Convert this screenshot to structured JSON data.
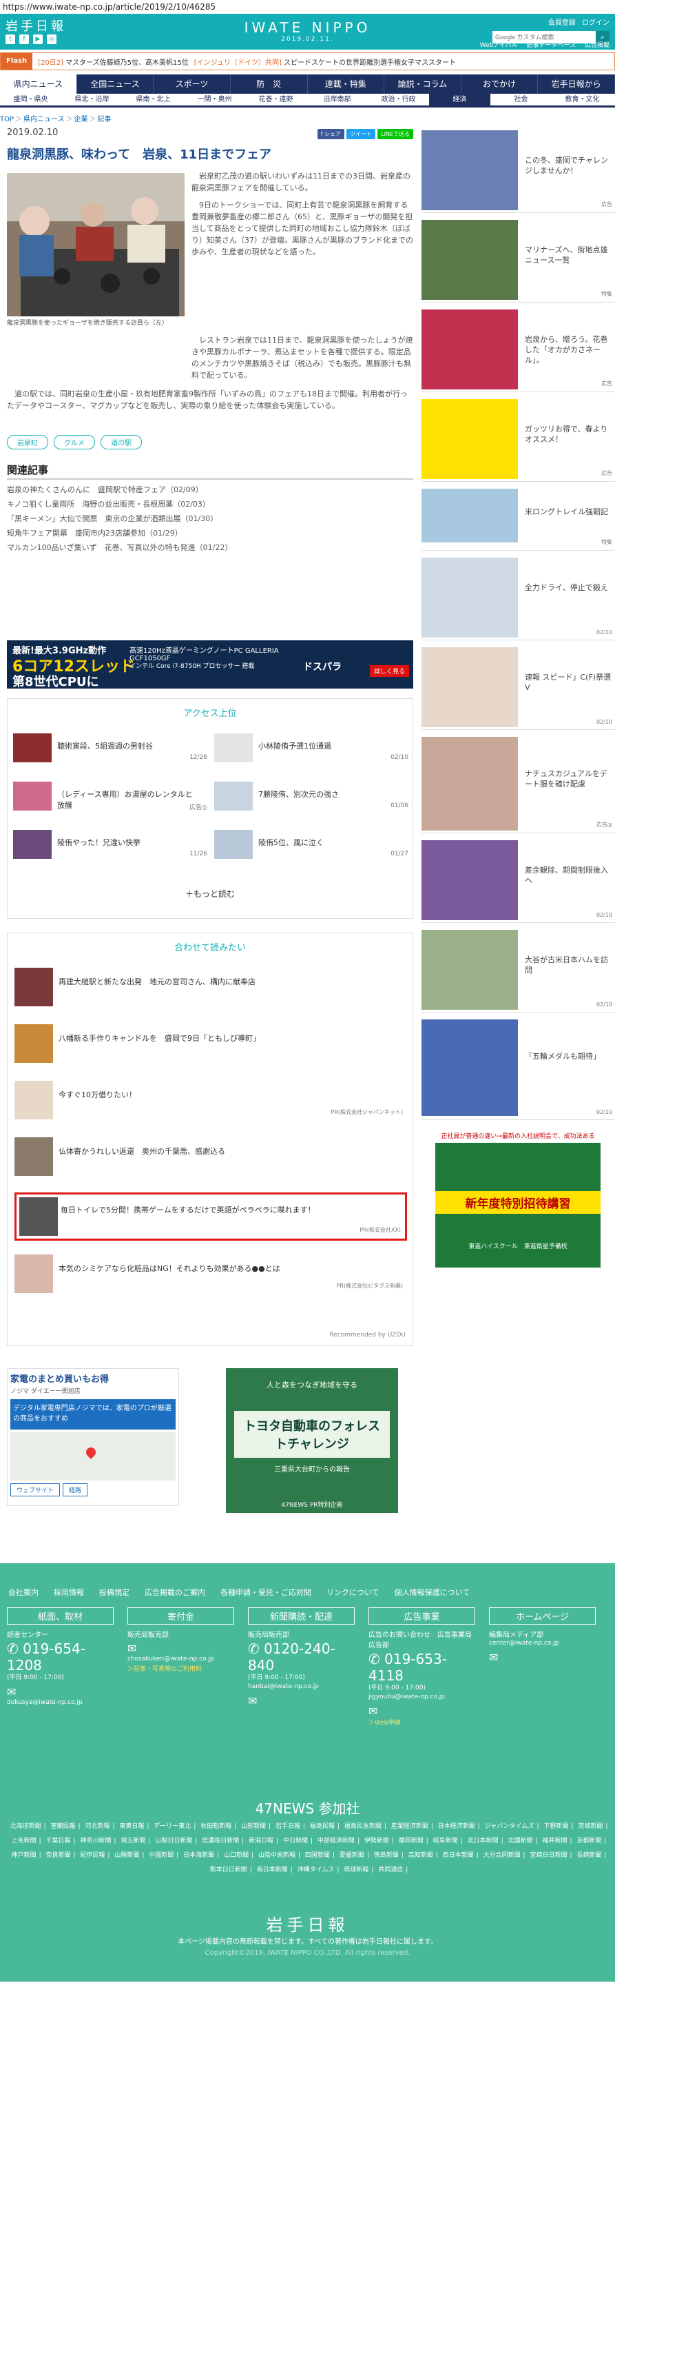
{
  "browser": {
    "url": "https://www.iwate-np.co.jp/article/2019/2/10/46285"
  },
  "header": {
    "logo": "岩手日報",
    "brand": "IWATE NIPPO",
    "date": "2019.02.11.",
    "links": [
      "会員登録",
      "ログイン"
    ],
    "search_placeholder": "Google カスタム検索",
    "sub_links": [
      "Webアイバル",
      "記事データベース",
      "広告掲載"
    ]
  },
  "flash": {
    "tag": "Flash",
    "items": [
      {
        "cat": "[20日2]",
        "text": "マスターズ佐藤綺乃5位、高木美帆15位"
      },
      {
        "cat": "[インジュリ（ドイツ）共同]",
        "text": "スピードスケートの世界距離別選手権女子マススタート"
      }
    ]
  },
  "nav": [
    "県内ニュース",
    "全国ニュース",
    "スポーツ",
    "防　災",
    "連載・特集",
    "論説・コラム",
    "おでかけ",
    "岩手日報から"
  ],
  "subnav": [
    "盛岡・県央",
    "県北・沿岸",
    "県南・北上",
    "一関・奥州",
    "花巻・遠野",
    "沿岸南部",
    "政治・行政",
    "経済",
    "社会",
    "教育・文化"
  ],
  "breadcrumb": [
    "TOP",
    "県内ニュース",
    "企業",
    "記事"
  ],
  "article": {
    "date": "2019.02.10",
    "share": [
      "f シェア",
      "ツイート",
      "LINEで送る"
    ],
    "title": "龍泉洞黒豚、味わって　岩泉、11日までフェア",
    "caption": "龍泉洞黒豚を使ったギョーザを焼き販売する店員ら（左）",
    "paragraphs": [
      "岩泉町乙茂の道の駅いわいずみは11日までの3日間、岩泉産の龍泉洞黒豚フェアを開催している。",
      "9日のトークショーでは、同町上有芸で龍泉洞黒豚を飼育する豊岡兼敬夢畜産の郷二郎さん（65）と、黒豚ギョーザの開発を担当して商品をとって提供した同町の地域おこし協力隊鈴木（ぼばり）知美さん（37）が登壇。黒豚さんが黒豚のブランド化までの歩みや、生産者の現状などを語った。",
      "レストラン岩泉では11日まで、龍泉洞黒豚を使ったしょうが焼きや黒豚カルボナーラ、煮込まセットを各種で提供する。限定品のメンチカツや黒豚焼きそば（税込み）でも販売。黒豚豚汁も無料で配っている。",
      "道の駅では、同町岩泉の生産小屋・玖有地肥育家畜9製作所「いずみの鳥」のフェアも18日まで開催。利用者が行ったデータやコースター、マグカップなどを販売し、実際の象り絵を使った体験会も実施している。"
    ],
    "tags": [
      "岩泉町",
      "グルメ",
      "道の駅"
    ]
  },
  "related": {
    "title": "関連記事",
    "items": [
      "岩泉の神たくさんのんに　盛岡駅で特産フェア（02/09）",
      "キノコ狙くし童雨所　海野の並出販売・長根周薬（02/03）",
      "「黒キーメン」大仙で開票　東京の企業が酒類出展（01/30）",
      "短角牛フェア開幕　盛岡市内23店舗参加（01/29）",
      "マルカン100品いざ集いず　花巻、写真以外の特も発進（01/22）"
    ]
  },
  "ad_banner": {
    "line1": "最新!最大3.9GHz動作",
    "line2": "6コア12スレッド",
    "line3": "第8世代CPUに",
    "right_title": "高速120Hz液晶ゲーミングノートPC GALLERIA GCF1050GF",
    "right_sub": "インテル Core i7-8750H プロセッサー 搭載",
    "right_brand": "ドスパラ",
    "right_btn": "詳しく見る"
  },
  "access": {
    "title": "アクセス上位",
    "items": [
      {
        "title": "聴術寅段、5組週週の男射谷",
        "date": "12/26"
      },
      {
        "title": "小林陵侑予選1位通過",
        "date": "02/10"
      },
      {
        "title": "（レディース専用）お湯屋のレンタルと放醸",
        "date": "広告◎"
      },
      {
        "title": "7勝陵侑、別次元の強さ",
        "date": "01/06"
      },
      {
        "title": "陵侑やった！兄違い快挙",
        "date": "11/26"
      },
      {
        "title": "陵侑5位、風に泣く",
        "date": "01/27"
      }
    ],
    "more": "＋もっと読む"
  },
  "recommend": {
    "title": "合わせて読みたい",
    "items": [
      {
        "title": "再建大槌駅と新たな出発　地元の宮司さん、構内に献奉店",
        "pr": ""
      },
      {
        "title": "八幡新る手作りキャンドルを　盛岡で9日「ともしび導町」",
        "pr": ""
      },
      {
        "title": "今すぐ10万借りたい！",
        "pr": "PR(株式会社ジャパンネット)"
      },
      {
        "title": "仏体寄かうれしい返還　奥州の千葉喬、感謝込る",
        "pr": ""
      },
      {
        "title": "毎日トイレで5分間！携帯ゲームをするだけで英語がペラペラに喋れます！",
        "pr": "PR(株式会社XX)"
      },
      {
        "title": "本気のシミケアなら化粧品はNG！それよりも効果がある●●とは",
        "pr": "PR(株式会社ビタクス新薬)"
      }
    ],
    "powered": "Recommended by  UZOU"
  },
  "bottom_ads": {
    "left_title": "家電のまとめ買いもお得",
    "left_sub": "ノジマ ダイエー一関旭店",
    "left_box": "デジタル家電専門店ノジマでは、家電のプロが厳選の商品をおすすめ",
    "left_btn1": "ウェブサイト",
    "left_btn2": "経路",
    "right_top": "人と森をつなぎ地域を守る",
    "right_main": "トヨタ自動車のフォレストチャレンジ",
    "right_sub": "三重県大台町からの報告",
    "right_foot": "47NEWS PR特別企画"
  },
  "sidebar": [
    {
      "title": "この冬、盛岡でチャレンジしませんか！",
      "label": "広告"
    },
    {
      "title": "マリナーズへ、街地点雄ニュース一覧",
      "label": "特集"
    },
    {
      "title": "岩泉から、贈ろう。花巻した「オカがカさネール」。",
      "label": "広告"
    },
    {
      "title": "ガッツリお得で、春よりオススメ！",
      "label": "広告"
    },
    {
      "title": "米ロングトレイル強靭記",
      "label": "特集"
    },
    {
      "title": "全力ドライ、停止で鍛え",
      "label": "02/10"
    },
    {
      "title": "速報 スピード」C(F)祭選Ⅴ",
      "label": "02/10"
    },
    {
      "title": "ナチュスカジュアルをデート服を確け配慮",
      "label": "広告◎"
    },
    {
      "title": "差余観除、期間制限後入へ",
      "label": "02/10"
    },
    {
      "title": "大谷が古米日本ハムを訪問",
      "label": "02/10"
    },
    {
      "title": "「五輪メダルも期待」",
      "label": "02/10"
    }
  ],
  "side_ad": {
    "top": "正社員が普通の違い→最新の入社説明会で、成功法ある",
    "mid": "新年度特別招待講習",
    "bottom": "東進ハイスクール　東進衛星予備校"
  },
  "footer": {
    "links": [
      "会社案内",
      "採用情報",
      "投稿規定",
      "広告掲載のご案内",
      "各種申請・受託・ご応対問",
      "リンクについて",
      "個人情報保護について"
    ],
    "cols": [
      {
        "head": "紙面、取材",
        "label": "読者センター",
        "tel": "019-654-1208",
        "hours": "(平日 9:00 - 17:00)",
        "mail": "dokusya@iwate-np.co.jp",
        "extra": ""
      },
      {
        "head": "寄付金",
        "label": "販売局販売部",
        "tel": "",
        "hours": "",
        "mail": "chosakuken@iwate-np.co.jp",
        "extra": "＞記事・写真等のご利用料"
      },
      {
        "head": "新聞購読・配達",
        "label": "販売局販売部",
        "tel": "0120-240-840",
        "hours": "(平日 9:00 - 17:00)",
        "mail": "hanbai@iwate-np.co.jp",
        "extra": ""
      },
      {
        "head": "広告事業",
        "label": "広告のお問い合わせ　広告事業局広告部",
        "tel": "019-653-4118",
        "hours": "(平日 9:00 - 17:00)",
        "mail": "jigyoubu@iwate-np.co.jp",
        "extra": "＞Web申請"
      },
      {
        "head": "ホームページ",
        "label": "編集局メディア部",
        "tel": "",
        "hours": "",
        "mail": "center@iwate-np.co.jp",
        "extra": ""
      }
    ],
    "news47": "47NEWS 参加社",
    "members": [
      "北海道新聞",
      "室蘭民報",
      "河北新報",
      "東奥日報",
      "デーリー東北",
      "秋田魁新報",
      "山形新聞",
      "岩手日報",
      "福島民報",
      "福島民友新聞",
      "産業経済新聞",
      "日本経済新聞",
      "ジャパンタイムズ",
      "下野新聞",
      "茨城新聞",
      "上毛新聞",
      "千葉日報",
      "神奈川新聞",
      "埼玉新聞",
      "山梨日日新聞",
      "信濃毎日新聞",
      "新潟日報",
      "中日新聞",
      "中部経済新聞",
      "伊勢新聞",
      "静岡新聞",
      "岐阜新聞",
      "北日本新聞",
      "北國新聞",
      "福井新聞",
      "京都新聞",
      "神戸新聞",
      "奈良新聞",
      "紀伊民報",
      "山陽新聞",
      "中國新聞",
      "日本海新聞",
      "山口新聞",
      "山陰中央新報",
      "四国新聞",
      "愛媛新聞",
      "徳島新聞",
      "高知新聞",
      "西日本新聞",
      "大分合同新聞",
      "宮崎日日新聞",
      "長崎新聞",
      "熊本日日新聞",
      "南日本新聞",
      "沖縄タイムス",
      "琉球新報",
      "共同通信"
    ],
    "logo": "岩手日報",
    "copy1": "本ページ掲載内容の無断転載を禁じます。すべての著作権は岩手日報社に属します。",
    "copy2": "Copyright©2019, IWATE NIPPO CO.,LTD. All rights reserved."
  }
}
